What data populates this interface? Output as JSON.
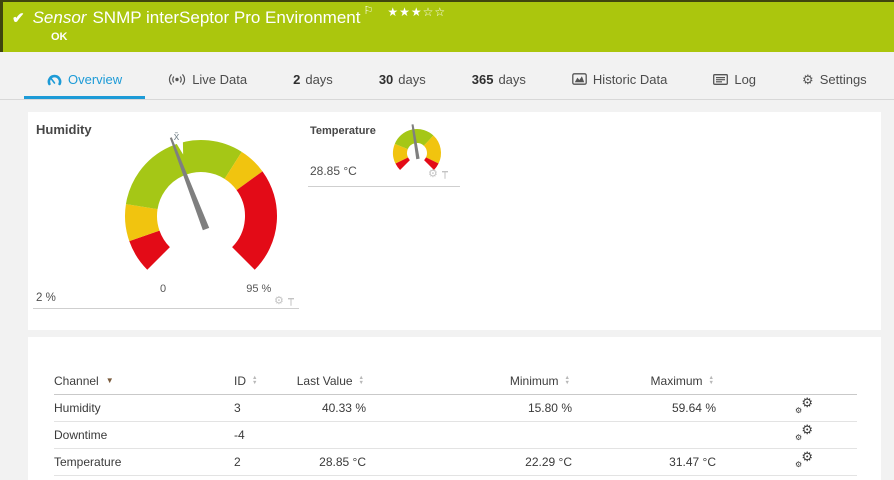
{
  "icons": {
    "check": "✔",
    "flag": "⚐",
    "gear": "⚙",
    "stars_filled": "★★★",
    "stars_empty": "☆☆",
    "sort_asc": "▲",
    "sort_desc": "▼",
    "sort_active_desc": "▼"
  },
  "header": {
    "type_label": "Sensor",
    "title": "SNMP interSeptor Pro Environment",
    "status": "OK",
    "rating_filled_count": 3,
    "rating_total": 5,
    "background_color": "#abc60d"
  },
  "tabs": {
    "overview": "Overview",
    "live_data": "Live Data",
    "d2_num": "2",
    "d2_label": "days",
    "d30_num": "30",
    "d30_label": "days",
    "d365_num": "365",
    "d365_label": "days",
    "historic": "Historic Data",
    "log": "Log",
    "settings": "Settings",
    "active_tab": "Overview",
    "accent_color": "#1d9bd7"
  },
  "gauges": [
    {
      "title": "Humidity",
      "corner_label": "2 %",
      "scale_min_label": "0",
      "scale_max_label": "95 %",
      "value_fraction": 0.422,
      "avg_fraction": 0.44,
      "avg_symbol": "x̄",
      "needle_color": "#7f7f7f",
      "segments": [
        {
          "from": 0,
          "to": 0.095,
          "color": "#e30b17"
        },
        {
          "from": 0.095,
          "to": 0.2,
          "color": "#f1c40f"
        },
        {
          "from": 0.2,
          "to": 0.62,
          "color": "#a5c716"
        },
        {
          "from": 0.62,
          "to": 0.7,
          "color": "#f1c40f"
        },
        {
          "from": 0.7,
          "to": 1,
          "color": "#e30b17"
        }
      ]
    },
    {
      "title": "Temperature",
      "value_label": "28.85 °C",
      "value_fraction": 0.467,
      "needle_color": "#7f7f7f",
      "segments": [
        {
          "from": 0,
          "to": 0.07,
          "color": "#e30b17"
        },
        {
          "from": 0.07,
          "to": 0.25,
          "color": "#f1c40f"
        },
        {
          "from": 0.25,
          "to": 0.66,
          "color": "#a5c716"
        },
        {
          "from": 0.66,
          "to": 0.93,
          "color": "#f1c40f"
        },
        {
          "from": 0.93,
          "to": 1,
          "color": "#e30b17"
        }
      ]
    }
  ],
  "table": {
    "headers": {
      "channel": "Channel",
      "id": "ID",
      "last_value": "Last Value",
      "minimum": "Minimum",
      "maximum": "Maximum"
    },
    "sorted_by": "Channel",
    "rows": [
      {
        "channel": "Humidity",
        "id": "3",
        "last_value": "40.33 %",
        "minimum": "15.80 %",
        "maximum": "59.64 %"
      },
      {
        "channel": "Downtime",
        "id": "-4",
        "last_value": "",
        "minimum": "",
        "maximum": ""
      },
      {
        "channel": "Temperature",
        "id": "2",
        "last_value": "28.85 °C",
        "minimum": "22.29 °C",
        "maximum": "31.47 °C"
      }
    ]
  }
}
